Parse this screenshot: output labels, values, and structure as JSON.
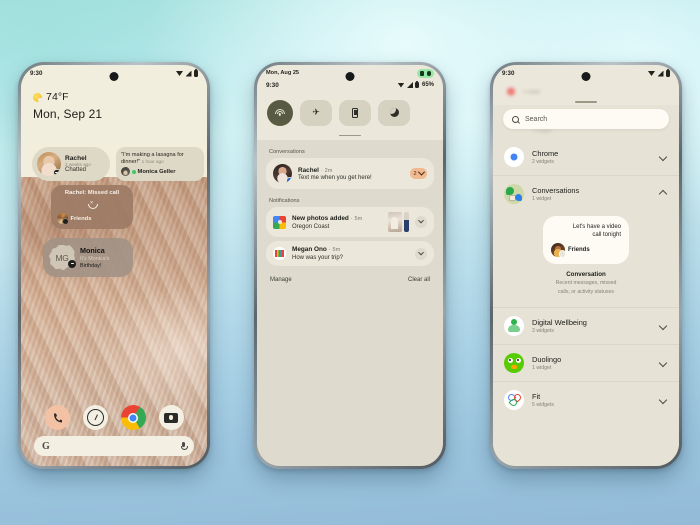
{
  "background": {
    "top_color": "#bfeaef",
    "bottom_color": "#93bbd8"
  },
  "phone1": {
    "name": "home-screen",
    "status_bar": {
      "time": "9:30",
      "icons": [
        "wifi-icon",
        "signal-icon",
        "battery-icon"
      ]
    },
    "weather": {
      "icon": "sun-icon",
      "temperature": "74°F"
    },
    "date": "Mon, Sep 21",
    "widgets": {
      "rachel_chip": {
        "name": "Rachel",
        "time_ago": "2 weeks ago",
        "status": "Chatted",
        "badge_icon": "message-badge-icon"
      },
      "monica_chip": {
        "quote": "\"I'm making a lasagna for dinner!\"",
        "time_ago": "1 hour ago",
        "name": "Monica Geller",
        "presence": "online"
      },
      "missed_call": {
        "title": "Rachel: Missed call",
        "icon": "missed-call-icon",
        "group": "Friends"
      },
      "monica_birthday": {
        "initials": "MG",
        "name": "Monica",
        "line1": "It's Monica's",
        "line2": "Birthday!",
        "badge_icon": "message-badge-icon"
      }
    },
    "dock": [
      {
        "label": "Phone",
        "icon": "phone-icon"
      },
      {
        "label": "Clock",
        "icon": "clock-icon"
      },
      {
        "label": "Chrome",
        "icon": "chrome-icon"
      },
      {
        "label": "Camera",
        "icon": "camera-icon"
      }
    ],
    "search": {
      "logo": "G",
      "placeholder": "",
      "mic_icon": "mic-icon"
    }
  },
  "phone2": {
    "name": "notification-shade",
    "status_bar": {
      "date": "Mon, Aug 25",
      "time": "9:30",
      "battery_percent": "65%",
      "privacy_indicator": [
        "camera-icon",
        "mic-icon"
      ]
    },
    "quick_settings": [
      {
        "label": "Wi-Fi",
        "icon": "wifi-icon",
        "active": true
      },
      {
        "label": "Airplane mode",
        "icon": "airplane-icon",
        "active": false
      },
      {
        "label": "Flashlight",
        "icon": "flashlight-icon",
        "active": false
      },
      {
        "label": "Do Not Disturb",
        "icon": "moon-icon",
        "active": false
      }
    ],
    "sections": {
      "conversations_label": "Conversations",
      "notifications_label": "Notifications"
    },
    "conversations": [
      {
        "sender": "Rachel",
        "separator": "·",
        "time": "2m",
        "message": "Text me when you get here!",
        "count": "2",
        "app_badge": "messages-icon"
      }
    ],
    "notifications": [
      {
        "title": "New photos added",
        "separator": "·",
        "time": "5m",
        "body": "Oregon Coast",
        "icon": "google-photos-icon",
        "has_thumbnails": true
      },
      {
        "title": "Megan Ono",
        "separator": "·",
        "time": "5m",
        "body": "How was your trip?",
        "icon": "gmail-icon",
        "has_thumbnails": false
      }
    ],
    "footer": {
      "manage": "Manage",
      "clear_all": "Clear all"
    }
  },
  "phone3": {
    "name": "widget-picker",
    "status_bar": {
      "time": "9:30",
      "icons": [
        "wifi-icon",
        "signal-icon",
        "battery-icon"
      ]
    },
    "partial_top_row": {
      "name": "",
      "count": "1 widget"
    },
    "search": {
      "placeholder": "Search",
      "icon": "search-icon"
    },
    "apps": [
      {
        "name": "Chrome",
        "count": "2 widgets",
        "icon": "chrome-icon",
        "expanded": false
      },
      {
        "name": "Conversations",
        "count": "1 widget",
        "icon": "conversations-icon",
        "expanded": true
      },
      {
        "name": "Digital Wellbeing",
        "count": "3 widgets",
        "icon": "digital-wellbeing-icon",
        "expanded": false
      },
      {
        "name": "Duolingo",
        "count": "1 widget",
        "icon": "duolingo-icon",
        "expanded": false
      },
      {
        "name": "Fit",
        "count": "5 widgets",
        "icon": "google-fit-icon",
        "expanded": false
      }
    ],
    "conversation_preview": {
      "message_line1": "Let's have a video",
      "message_line2": "call tonight",
      "contact": "Friends",
      "widget_title": "Conversation",
      "widget_desc_line1": "Recent messages, missed",
      "widget_desc_line2": "calls, or activity statuses"
    }
  }
}
